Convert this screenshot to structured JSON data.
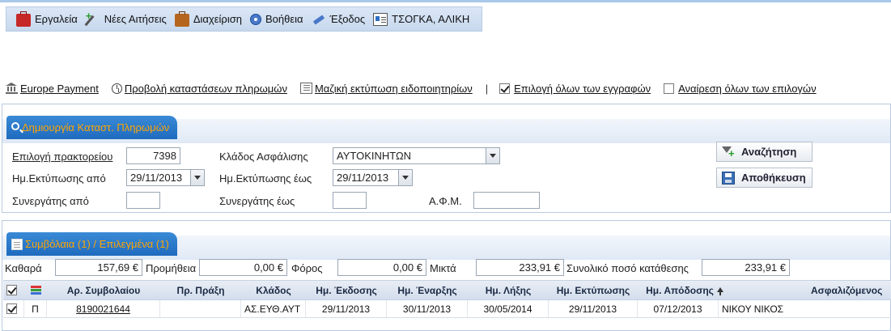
{
  "menu": {
    "items": [
      {
        "label": "Εργαλεία",
        "icon": "toolbox-icon"
      },
      {
        "label": "Νέες Αιτήσεις",
        "icon": "wand-icon"
      },
      {
        "label": "Διαχείριση",
        "icon": "briefcase-icon"
      },
      {
        "label": "Βοήθεια",
        "icon": "help-icon"
      },
      {
        "label": "Έξοδος",
        "icon": "exit-icon"
      },
      {
        "label": "ΤΣΟΓΚΑ, ΑΛΙΚΗ",
        "icon": "user-card-icon"
      }
    ]
  },
  "toolbar": {
    "europe_payment": "Europe Payment",
    "view_statements": "Προβολή καταστάσεων πληρωμών",
    "mass_print": "Μαζική εκτύπωση ειδοποιητηρίων",
    "separator": "|",
    "select_all": "Επιλογή όλων των εγγραφών",
    "deselect_all": "Αναίρεση όλων των επιλογών"
  },
  "search_panel": {
    "title": "Δημιουργία Καταστ. Πληρωμών",
    "agency_label": "Επιλογή πρακτορείου",
    "agency_value": "7398",
    "branch_label": "Κλάδος Ασφάλισης",
    "branch_value": "ΑΥΤΟΚΙΝΗΤΩΝ",
    "print_from_label": "Ημ.Εκτύπωσης από",
    "print_from_value": "29/11/2013",
    "print_to_label": "Ημ.Εκτύπωσης έως",
    "print_to_value": "29/11/2013",
    "partner_from_label": "Συνεργάτης από",
    "partner_from_value": "",
    "partner_to_label": "Συνεργάτης έως",
    "partner_to_value": "",
    "afm_label": "Α.Φ.Μ.",
    "afm_value": "",
    "search_button": "Αναζήτηση",
    "save_button": "Αποθήκευση"
  },
  "contracts_panel": {
    "title": "Συμβόλαια (1) / Επιλεγμένα (1)",
    "net_label": "Καθαρά",
    "net_value": "157,69 €",
    "commission_label": "Προμήθεια",
    "commission_value": "0,00 €",
    "tax_label": "Φόρος",
    "tax_value": "0,00 €",
    "gross_label": "Μικτά",
    "gross_value": "233,91 €",
    "total_deposit_label": "Συνολικό ποσό κατάθεσης",
    "total_deposit_value": "233,91 €",
    "columns": [
      "Αρ. Συμβολαίου",
      "Πρ. Πράξη",
      "Κλάδος",
      "Ημ. Έκδοσης",
      "Ημ. Έναρξης",
      "Ημ. Λήξης",
      "Ημ. Εκτύπωσης",
      "Ημ. Απόδοσης",
      "Ασφαλιζόμενος"
    ],
    "rows": [
      {
        "type": "Π",
        "policy_no": "8190021644",
        "prev_act": "",
        "branch": "ΑΣ.ΕΥΘ.ΑΥΤ",
        "issue_date": "29/11/2013",
        "start_date": "30/11/2013",
        "end_date": "30/05/2014",
        "print_date": "29/11/2013",
        "payment_date": "07/12/2013",
        "insured": "ΝΙΚΟΥ ΝΙΚΟΣ"
      }
    ]
  }
}
